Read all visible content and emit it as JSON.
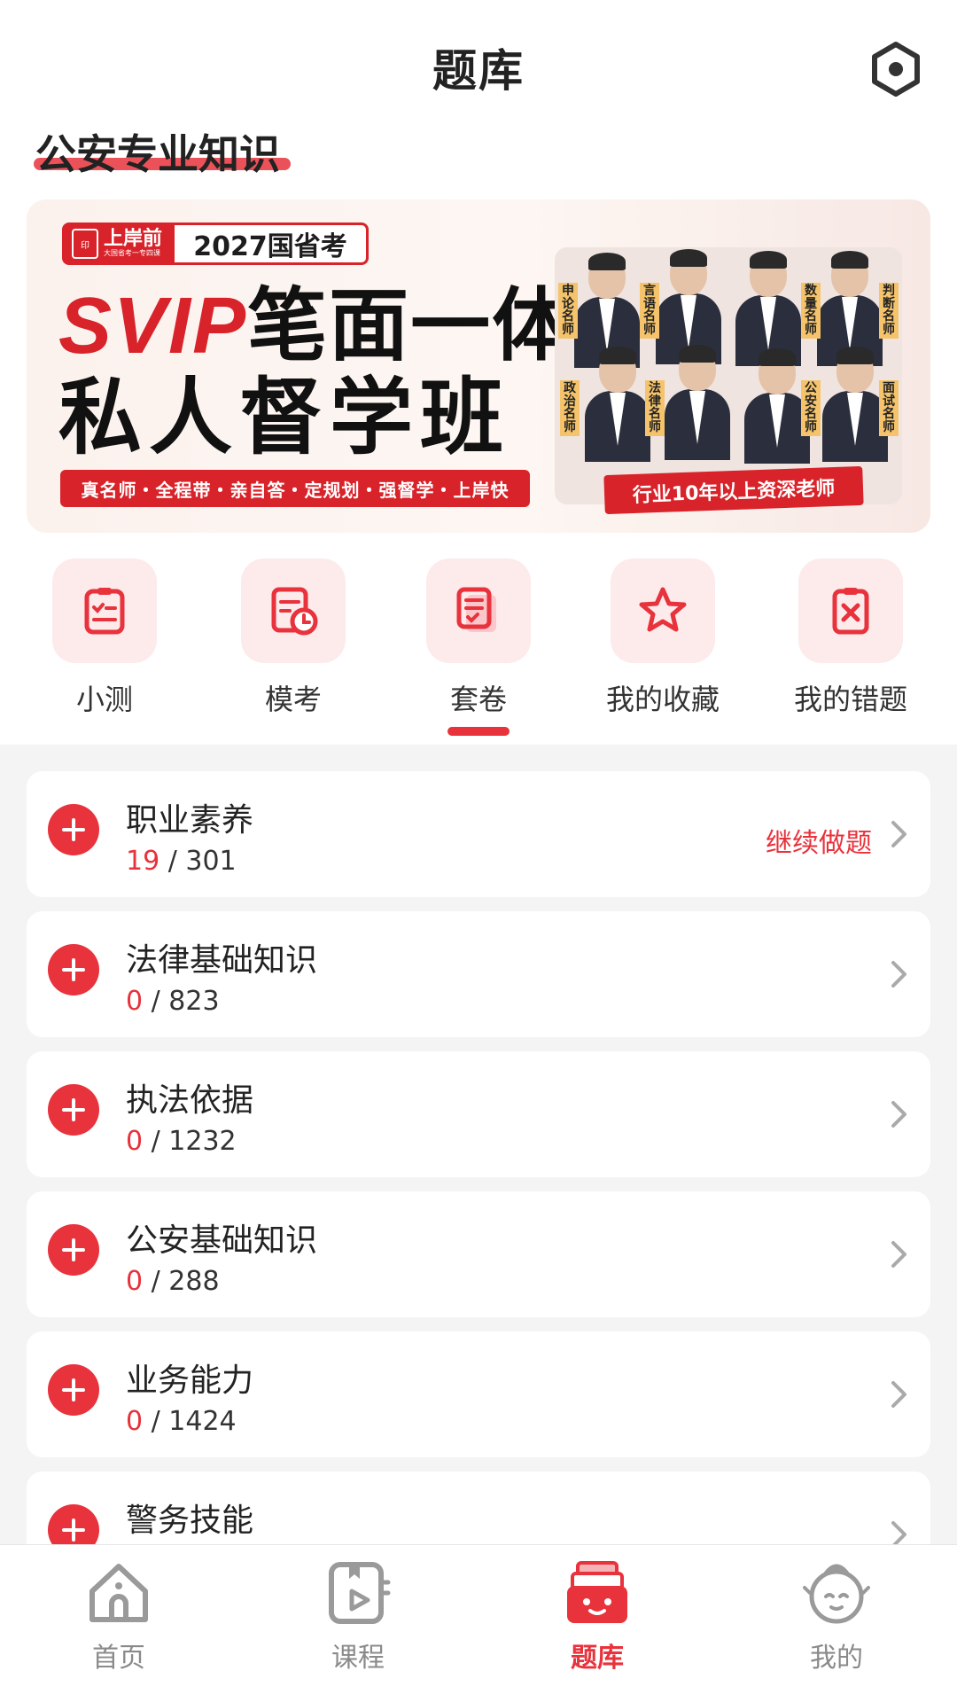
{
  "header": {
    "title": "题库",
    "settings_icon": "settings-hex-icon"
  },
  "subject": {
    "title": "公安专业知识"
  },
  "banner": {
    "brand_name": "上岸前",
    "brand_sub": "大国省考一专四课",
    "exam": "2027国省考",
    "headline_svip": "SVIP",
    "headline_rest": "笔面一体",
    "headline2": "私人督学班",
    "tags": "真名师・全程带・亲自答・定规划・强督学・上岸快",
    "teacher_labels": [
      "申论名师",
      "言语名师",
      "数量名师",
      "判断名师",
      "政治名师",
      "法律名师",
      "公安名师",
      "面试名师"
    ],
    "caption": "行业10年以上资深老师"
  },
  "categories": [
    {
      "label": "小测",
      "icon": "quiz-icon",
      "active": false
    },
    {
      "label": "模考",
      "icon": "mock-exam-icon",
      "active": false
    },
    {
      "label": "套卷",
      "icon": "paper-set-icon",
      "active": true
    },
    {
      "label": "我的收藏",
      "icon": "star-icon",
      "active": false
    },
    {
      "label": "我的错题",
      "icon": "wrong-question-icon",
      "active": false
    }
  ],
  "topics": [
    {
      "name": "职业素养",
      "done": "19",
      "total": "/ 301",
      "action": "继续做题"
    },
    {
      "name": "法律基础知识",
      "done": "0",
      "total": "/ 823",
      "action": ""
    },
    {
      "name": "执法依据",
      "done": "0",
      "total": "/ 1232",
      "action": ""
    },
    {
      "name": "公安基础知识",
      "done": "0",
      "total": "/ 288",
      "action": ""
    },
    {
      "name": "业务能力",
      "done": "0",
      "total": "/ 1424",
      "action": ""
    },
    {
      "name": "警务技能",
      "done": "",
      "total": "",
      "action": ""
    }
  ],
  "tabbar": [
    {
      "label": "首页",
      "icon": "home-icon",
      "active": false
    },
    {
      "label": "课程",
      "icon": "course-video-icon",
      "active": false
    },
    {
      "label": "题库",
      "icon": "question-bank-icon",
      "active": true
    },
    {
      "label": "我的",
      "icon": "profile-mascot-icon",
      "active": false
    }
  ],
  "colors": {
    "accent": "#e8323c",
    "banner_red": "#d8232a"
  }
}
